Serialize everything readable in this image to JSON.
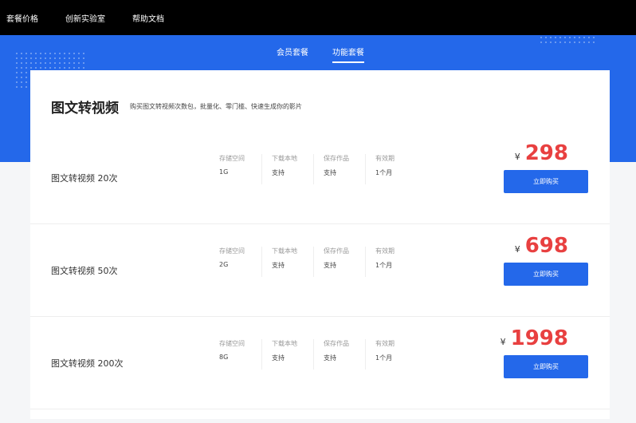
{
  "nav": {
    "items": [
      "套餐价格",
      "创新实验室",
      "帮助文档"
    ]
  },
  "tabs": [
    {
      "label": "会员套餐",
      "active": false
    },
    {
      "label": "功能套餐",
      "active": true
    }
  ],
  "section": {
    "title": "图文转视频",
    "subtitle": "购买图文转视频次数包，批量化、零门槛、快速生成你的影片"
  },
  "spec_labels": [
    "存储空间",
    "下载本地",
    "保存作品",
    "有效期"
  ],
  "currency": "¥",
  "buy_label": "立即购买",
  "packages": [
    {
      "name": "图文转视频 20次",
      "specs": [
        "1G",
        "支持",
        "支持",
        "1个月"
      ],
      "price": "298"
    },
    {
      "name": "图文转视频 50次",
      "specs": [
        "2G",
        "支持",
        "支持",
        "1个月"
      ],
      "price": "698"
    },
    {
      "name": "图文转视频 200次",
      "specs": [
        "8G",
        "支持",
        "支持",
        "1个月"
      ],
      "price": "1998"
    }
  ]
}
